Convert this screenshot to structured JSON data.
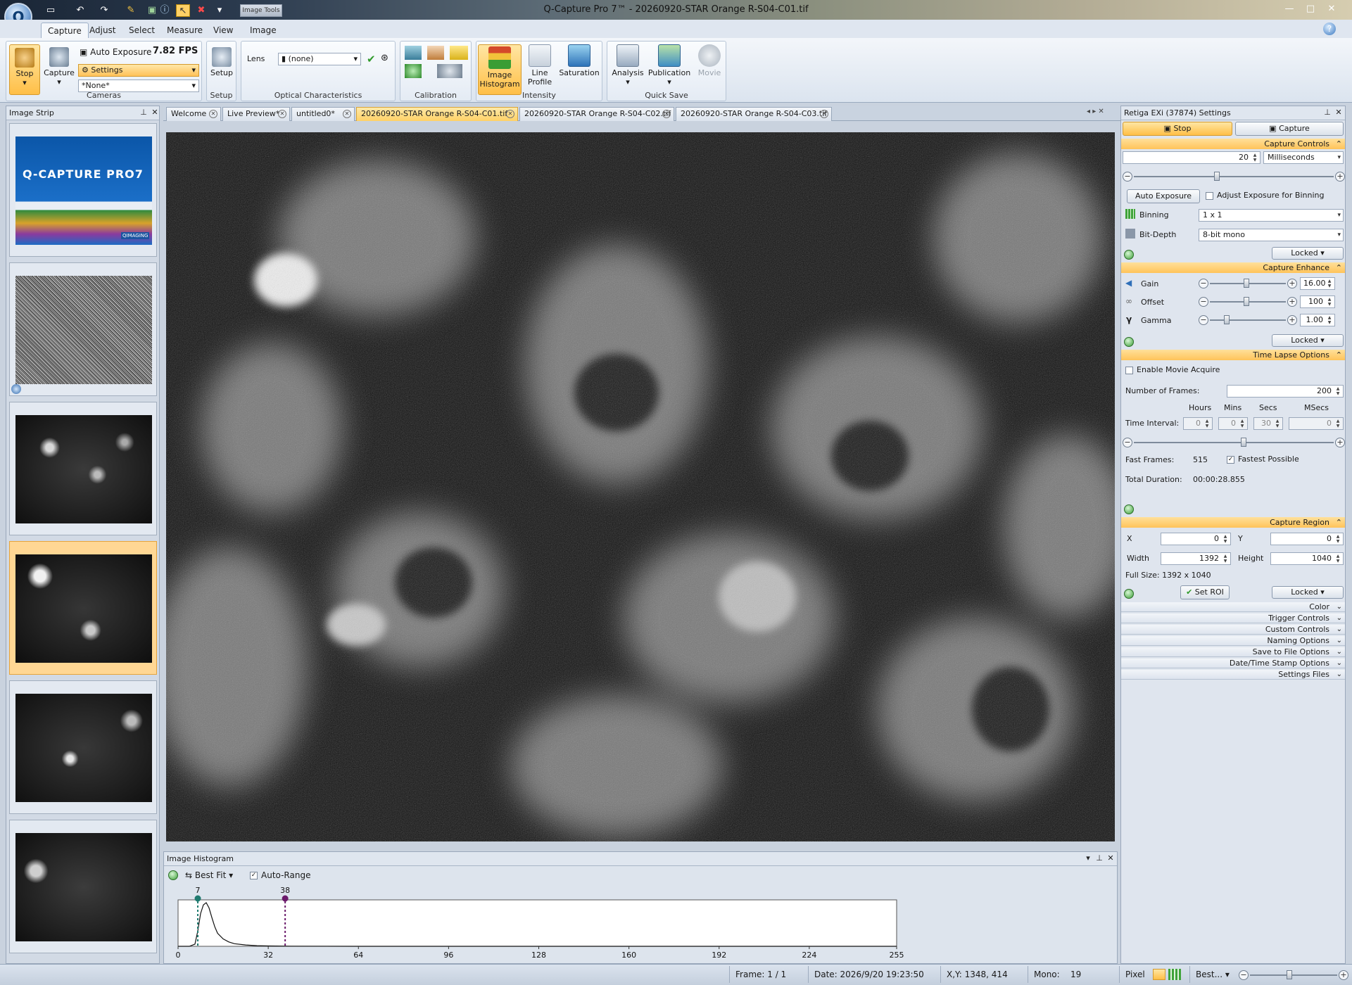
{
  "window": {
    "title": "Q-Capture Pro 7™ - 20260920-STAR Orange R-S04-C01.tif",
    "context_tab": "Image Tools"
  },
  "ribbon_tabs": [
    "Capture",
    "Adjust",
    "Select",
    "Measure",
    "View",
    "Image"
  ],
  "ribbon": {
    "stop_label": "Stop",
    "capture_label": "Capture",
    "auto_exposure_label": "Auto Exposure",
    "fps": "7.82 FPS",
    "settings_select": "Settings",
    "preset_select": "*None*",
    "cameras_group": "Cameras",
    "setup_label": "Setup",
    "setup_group": "Setup",
    "lens_label": "Lens",
    "lens_value": "(none)",
    "optical_group": "Optical Characteristics",
    "calibration_group": "Calibration",
    "histogram_label_1": "Image",
    "histogram_label_2": "Histogram",
    "line_profile_1": "Line",
    "line_profile_2": "Profile",
    "saturation_label": "Saturation",
    "intensity_group": "Intensity",
    "analysis_label": "Analysis",
    "publication_label": "Publication",
    "movie_label": "Movie",
    "quicksave_group": "Quick Save"
  },
  "image_strip": {
    "title": "Image Strip",
    "splash_title": "Q-CAPTURE PRO7",
    "splash_brand": "QIMAGING"
  },
  "doc_tabs": [
    "Welcome",
    "Live Preview*",
    "untitled0*",
    "20260920-STAR Orange R-S04-C01.tif",
    "20260920-STAR Orange R-S04-C02.tif",
    "20260920-STAR Orange R-S04-C03.tif"
  ],
  "histogram": {
    "title": "Image Histogram",
    "fit_label": "Best Fit",
    "auto_range_label": "Auto-Range",
    "low_marker": "7",
    "high_marker": "38",
    "axis_ticks": [
      "0",
      "32",
      "64",
      "96",
      "128",
      "160",
      "192",
      "224",
      "255"
    ]
  },
  "settings": {
    "title": "Retiga EXi (37874) Settings",
    "stop_button": "Stop",
    "capture_button": "Capture",
    "capture_controls": {
      "header": "Capture Controls",
      "exposure_value": "20",
      "exposure_unit": "Milliseconds",
      "auto_exposure": "Auto Exposure",
      "adjust_binning": "Adjust Exposure for Binning",
      "binning_label": "Binning",
      "binning_value": "1 x 1",
      "bitdepth_label": "Bit-Depth",
      "bitdepth_value": "8-bit mono",
      "locked": "Locked"
    },
    "capture_enhance": {
      "header": "Capture Enhance",
      "gain_label": "Gain",
      "gain_value": "16.00",
      "offset_label": "Offset",
      "offset_value": "100",
      "gamma_label": "Gamma",
      "gamma_value": "1.00",
      "locked": "Locked"
    },
    "time_lapse": {
      "header": "Time Lapse Options",
      "enable_movie": "Enable Movie Acquire",
      "frames_label": "Number of Frames:",
      "frames_value": "200",
      "hours": "Hours",
      "mins": "Mins",
      "secs": "Secs",
      "msecs": "MSecs",
      "interval_label": "Time Interval:",
      "h_val": "0",
      "m_val": "0",
      "s_val": "30",
      "ms_val": "0",
      "fast_frames_label": "Fast Frames:",
      "fast_frames_value": "515",
      "fastest_possible": "Fastest Possible",
      "total_duration_label": "Total Duration:",
      "total_duration_value": "00:00:28.855"
    },
    "capture_region": {
      "header": "Capture Region",
      "x_label": "X",
      "x_value": "0",
      "y_label": "Y",
      "y_value": "0",
      "width_label": "Width",
      "width_value": "1392",
      "height_label": "Height",
      "height_value": "1040",
      "full_size": "Full Size: 1392 x 1040",
      "set_roi": "Set ROI",
      "locked": "Locked"
    },
    "collapsed_sections": [
      "Color",
      "Trigger Controls",
      "Custom Controls",
      "Naming Options",
      "Save to File Options",
      "Date/Time Stamp Options",
      "Settings Files"
    ]
  },
  "status": {
    "frame": "Frame: 1 / 1",
    "date": "Date: 2026/9/20 19:23:50",
    "xy": "X,Y: 1348,  414",
    "mono_label": "Mono:",
    "mono_value": "19",
    "pixel": "Pixel",
    "zoom_mode": "Best..."
  },
  "chart_data": {
    "type": "line",
    "x": [
      0,
      4,
      6,
      7,
      8,
      9,
      10,
      11,
      12,
      13,
      14,
      16,
      18,
      20,
      24,
      28,
      32,
      40,
      64,
      128,
      255
    ],
    "values": [
      0,
      0,
      0.05,
      0.35,
      0.75,
      0.95,
      1.0,
      0.88,
      0.66,
      0.45,
      0.3,
      0.17,
      0.1,
      0.06,
      0.03,
      0.015,
      0.008,
      0.003,
      0.0,
      0.0,
      0.0
    ],
    "xlim": [
      0,
      255
    ],
    "xticks": [
      0,
      32,
      64,
      96,
      128,
      160,
      192,
      224,
      255
    ],
    "markers": [
      {
        "label": "7",
        "x": 7,
        "color": "#1f7a6f"
      },
      {
        "label": "38",
        "x": 38,
        "color": "#6b1a6b"
      }
    ]
  }
}
